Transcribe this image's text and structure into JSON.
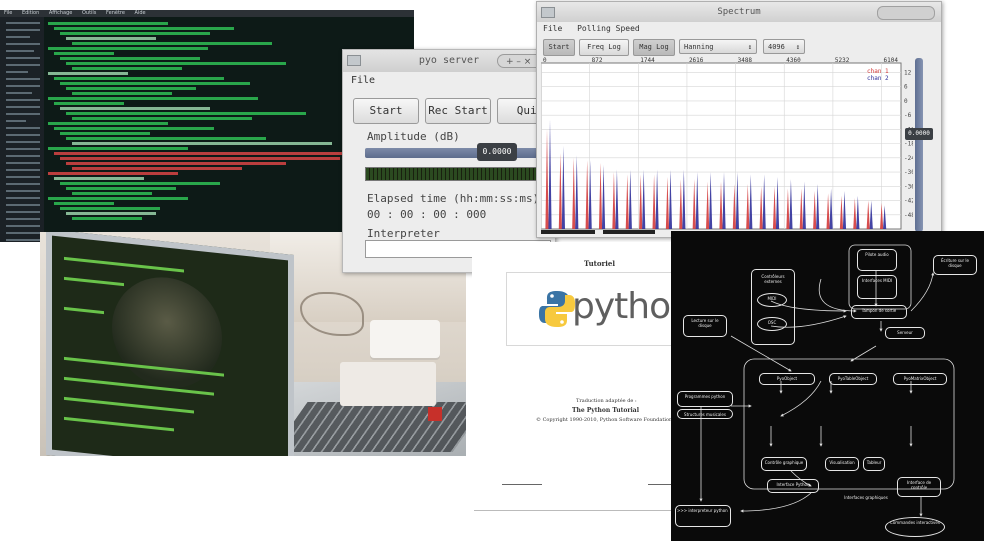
{
  "editor": {
    "menu": [
      "File",
      "Edition",
      "Affichage",
      "Outils",
      "Fenêtre",
      "Aide"
    ]
  },
  "pyo_server": {
    "title": "pyo server",
    "menu_file": "File",
    "start": "Start",
    "rec_start": "Rec Start",
    "quit": "Quit",
    "amplitude_label": "Amplitude (dB)",
    "amplitude_value": "0.0000",
    "elapsed_label": "Elapsed time (hh:mm:ss:ms)",
    "elapsed_value": "00 : 00 : 00 : 000",
    "interpreter_label": "Interpreter"
  },
  "spectrum": {
    "title": "Spectrum",
    "menu": [
      "File",
      "Polling Speed"
    ],
    "start": "Start",
    "freq_log": "Freq Log",
    "mag_log": "Mag Log",
    "window": "Hanning",
    "size": "4096",
    "gain_value": "0.0000",
    "legend": [
      "chan 1",
      "chan 2"
    ],
    "colors": {
      "chan1": "#d33b3b",
      "chan2": "#2f2f9a"
    }
  },
  "chart_data": {
    "type": "bar",
    "x_ticks": [
      "0",
      "872",
      "1744",
      "2616",
      "3488",
      "4360",
      "5232",
      "6104"
    ],
    "y_ticks": [
      "12",
      "6",
      "0",
      "-6",
      "-12",
      "-18",
      "-24",
      "-30",
      "-36",
      "-42",
      "-48"
    ],
    "series": [
      {
        "name": "chan 1",
        "values": [
          -12,
          -22,
          -24,
          -25,
          -26,
          -30,
          -31,
          -31,
          -31,
          -32,
          -33,
          -33,
          -34,
          -34,
          -35,
          -35,
          -36,
          -36,
          -37,
          -37,
          -38,
          -39,
          -40,
          -41,
          -42,
          -43
        ]
      },
      {
        "name": "chan 2",
        "values": [
          -8,
          -19,
          -23,
          -25,
          -27,
          -29,
          -29,
          -29,
          -29,
          -29,
          -29,
          -30,
          -30,
          -30,
          -30,
          -31,
          -31,
          -32,
          -33,
          -34,
          -35,
          -37,
          -38,
          -40,
          -42,
          -44
        ]
      }
    ],
    "ylim": [
      -54,
      16
    ]
  },
  "doc": {
    "label": "Tutoriel",
    "logo_word": "python",
    "line1": "Traduction adaptée de :",
    "line2": "The Python Tutorial",
    "line3": "© Copyright 1990-2010, Python Software Foundation."
  },
  "diagram": {
    "nodes": [
      {
        "id": "n1",
        "text": "Pilote audio"
      },
      {
        "id": "n2",
        "text": "Interfaces MIDI"
      },
      {
        "id": "n3",
        "text": "Écriture sur le disque"
      },
      {
        "id": "n4",
        "text": "Contrôleurs externes"
      },
      {
        "id": "n5",
        "text": "MIDI"
      },
      {
        "id": "n6",
        "text": "OSC"
      },
      {
        "id": "n7",
        "text": "Lecture sur le disque"
      },
      {
        "id": "n8",
        "text": "Tampon de sortie"
      },
      {
        "id": "n9",
        "text": "Serveur"
      },
      {
        "id": "n10",
        "text": "PyoObject"
      },
      {
        "id": "n11",
        "text": "PyoTableObject"
      },
      {
        "id": "n12",
        "text": "PyoMatrixObject"
      },
      {
        "id": "n13",
        "text": "Programmes python"
      },
      {
        "id": "n14",
        "text": "Structures musicales"
      },
      {
        "id": "n15",
        "text": "Contrôle graphique"
      },
      {
        "id": "n16",
        "text": "Visualisation"
      },
      {
        "id": "n17",
        "text": "Tableur"
      },
      {
        "id": "n18",
        "text": "Interface Python"
      },
      {
        "id": "n19",
        "text": "Interface de contrôle"
      },
      {
        "id": "n20",
        "text": ">>> interpreteur python"
      },
      {
        "id": "n21",
        "text": "Commandes interactives"
      },
      {
        "id": "n22",
        "text": "Interfaces graphiques"
      }
    ]
  }
}
